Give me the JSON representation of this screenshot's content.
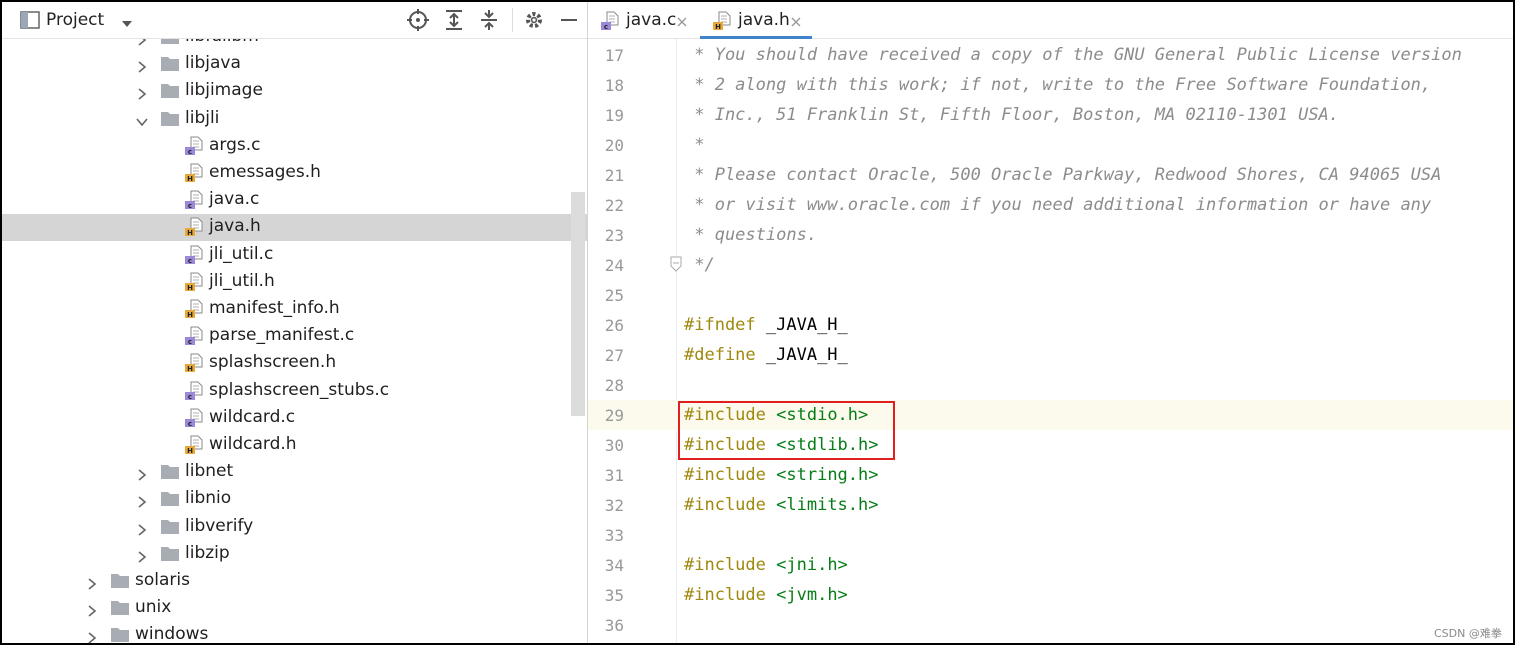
{
  "project": {
    "title": "Project",
    "tree": [
      {
        "label": "libfdlibm",
        "kind": "folder",
        "indent": 2,
        "expanded": false,
        "partial": true
      },
      {
        "label": "libjava",
        "kind": "folder",
        "indent": 2,
        "expanded": false
      },
      {
        "label": "libjimage",
        "kind": "folder",
        "indent": 2,
        "expanded": false
      },
      {
        "label": "libjli",
        "kind": "folder",
        "indent": 2,
        "expanded": true
      },
      {
        "label": "args.c",
        "kind": "c-file",
        "indent": 3
      },
      {
        "label": "emessages.h",
        "kind": "h-file",
        "indent": 3
      },
      {
        "label": "java.c",
        "kind": "c-file",
        "indent": 3
      },
      {
        "label": "java.h",
        "kind": "h-file",
        "indent": 3,
        "selected": true
      },
      {
        "label": "jli_util.c",
        "kind": "c-file",
        "indent": 3
      },
      {
        "label": "jli_util.h",
        "kind": "h-file",
        "indent": 3
      },
      {
        "label": "manifest_info.h",
        "kind": "h-file",
        "indent": 3
      },
      {
        "label": "parse_manifest.c",
        "kind": "c-file",
        "indent": 3
      },
      {
        "label": "splashscreen.h",
        "kind": "h-file",
        "indent": 3
      },
      {
        "label": "splashscreen_stubs.c",
        "kind": "c-file",
        "indent": 3
      },
      {
        "label": "wildcard.c",
        "kind": "c-file",
        "indent": 3
      },
      {
        "label": "wildcard.h",
        "kind": "h-file",
        "indent": 3
      },
      {
        "label": "libnet",
        "kind": "folder",
        "indent": 2,
        "expanded": false
      },
      {
        "label": "libnio",
        "kind": "folder",
        "indent": 2,
        "expanded": false
      },
      {
        "label": "libverify",
        "kind": "folder",
        "indent": 2,
        "expanded": false
      },
      {
        "label": "libzip",
        "kind": "folder",
        "indent": 2,
        "expanded": false
      },
      {
        "label": "solaris",
        "kind": "folder",
        "indent": 1,
        "expanded": false
      },
      {
        "label": "unix",
        "kind": "folder",
        "indent": 1,
        "expanded": false
      },
      {
        "label": "windows",
        "kind": "folder",
        "indent": 1,
        "expanded": false
      }
    ]
  },
  "editor": {
    "tabs": [
      {
        "label": "java.c",
        "kind": "c-file",
        "active": false
      },
      {
        "label": "java.h",
        "kind": "h-file",
        "active": true
      }
    ],
    "lines": [
      {
        "num": "17",
        "tokens": [
          {
            "t": " * You should have received a copy of the GNU General Public License version",
            "c": "comment"
          }
        ]
      },
      {
        "num": "18",
        "tokens": [
          {
            "t": " * 2 along with this work; if not, write to the Free Software Foundation,",
            "c": "comment"
          }
        ]
      },
      {
        "num": "19",
        "tokens": [
          {
            "t": " * Inc., 51 Franklin St, Fifth Floor, Boston, MA 02110-1301 USA.",
            "c": "comment"
          }
        ]
      },
      {
        "num": "20",
        "tokens": [
          {
            "t": " *",
            "c": "comment"
          }
        ]
      },
      {
        "num": "21",
        "tokens": [
          {
            "t": " * Please contact Oracle, 500 Oracle Parkway, Redwood Shores, CA 94065 USA",
            "c": "comment"
          }
        ]
      },
      {
        "num": "22",
        "tokens": [
          {
            "t": " * or visit www.oracle.com if you need additional information or have any",
            "c": "comment"
          }
        ]
      },
      {
        "num": "23",
        "tokens": [
          {
            "t": " * questions.",
            "c": "comment"
          }
        ]
      },
      {
        "num": "24",
        "tokens": [
          {
            "t": " */",
            "c": "comment"
          }
        ]
      },
      {
        "num": "25",
        "tokens": []
      },
      {
        "num": "26",
        "tokens": [
          {
            "t": "#ifndef",
            "c": "kw"
          },
          {
            "t": " _JAVA_H_",
            "c": "sym"
          }
        ]
      },
      {
        "num": "27",
        "tokens": [
          {
            "t": "#define",
            "c": "kw"
          },
          {
            "t": " _JAVA_H_",
            "c": "sym"
          }
        ]
      },
      {
        "num": "28",
        "tokens": []
      },
      {
        "num": "29",
        "current": true,
        "tokens": [
          {
            "t": "#include",
            "c": "kw"
          },
          {
            "t": " ",
            "c": "sym"
          },
          {
            "t": "<stdio.h>",
            "c": "str"
          }
        ]
      },
      {
        "num": "30",
        "tokens": [
          {
            "t": "#include",
            "c": "kw"
          },
          {
            "t": " ",
            "c": "sym"
          },
          {
            "t": "<stdlib.h>",
            "c": "str"
          }
        ]
      },
      {
        "num": "31",
        "tokens": [
          {
            "t": "#include",
            "c": "kw"
          },
          {
            "t": " ",
            "c": "sym"
          },
          {
            "t": "<string.h>",
            "c": "str"
          }
        ]
      },
      {
        "num": "32",
        "tokens": [
          {
            "t": "#include",
            "c": "kw"
          },
          {
            "t": " ",
            "c": "sym"
          },
          {
            "t": "<limits.h>",
            "c": "str"
          }
        ]
      },
      {
        "num": "33",
        "tokens": []
      },
      {
        "num": "34",
        "tokens": [
          {
            "t": "#include",
            "c": "kw"
          },
          {
            "t": " ",
            "c": "sym"
          },
          {
            "t": "<jni.h>",
            "c": "str"
          }
        ]
      },
      {
        "num": "35",
        "tokens": [
          {
            "t": "#include",
            "c": "kw"
          },
          {
            "t": " ",
            "c": "sym"
          },
          {
            "t": "<jvm.h>",
            "c": "str"
          }
        ]
      },
      {
        "num": "36",
        "tokens": []
      }
    ]
  },
  "watermark": "CSDN @难拳",
  "icon_names": {
    "project_view": "project-view-icon",
    "dropdown": "chevron-down-icon",
    "locate": "locate-target-icon",
    "expand_all": "expand-all-icon",
    "collapse_all": "collapse-all-icon",
    "settings": "gear-icon",
    "hide": "minimize-icon"
  },
  "colors": {
    "selection": "#d5d5d5",
    "keyword": "#9e880d",
    "string": "#067d17",
    "comment": "#8c8c8c",
    "current_line": "#fcfaed",
    "active_tab_underline": "#4083c9",
    "annotation_box": "#e02020"
  }
}
